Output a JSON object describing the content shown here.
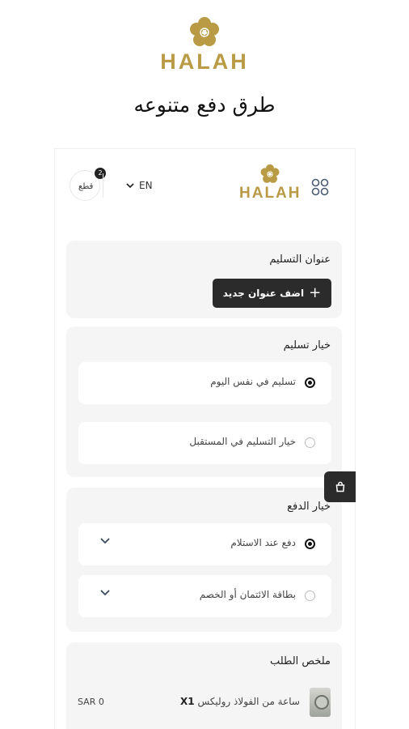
{
  "top": {
    "brand": "HALAH",
    "title": "طرق دفع متنوعه"
  },
  "header": {
    "brand": "HALAH",
    "language": "EN",
    "cart_count": "2",
    "cart_label": "قطع"
  },
  "delivery_address": {
    "title": "عنوان التسليم",
    "add_button": "اضف عنوان جديد"
  },
  "delivery_options": {
    "title": "خيار تسليم",
    "items": [
      {
        "label": "تسليم في نفس اليوم",
        "selected": true
      },
      {
        "label": "خيار التسليم في المستقبل",
        "selected": false
      }
    ]
  },
  "payment_options": {
    "title": "خيار الدفع",
    "items": [
      {
        "label": "دفع عند الاستلام",
        "selected": true
      },
      {
        "label": "بطاقة الائتمان أو الخصم",
        "selected": false
      }
    ]
  },
  "order_summary": {
    "title": "ملخص الطلب",
    "item": {
      "quantity": "X1",
      "name": "ساعة من الفولاذ روليكس",
      "price": "SAR 0"
    }
  },
  "colors": {
    "gold": "#b99a45",
    "dark": "#2b2b2b",
    "card_bg": "#f5f5f5"
  }
}
